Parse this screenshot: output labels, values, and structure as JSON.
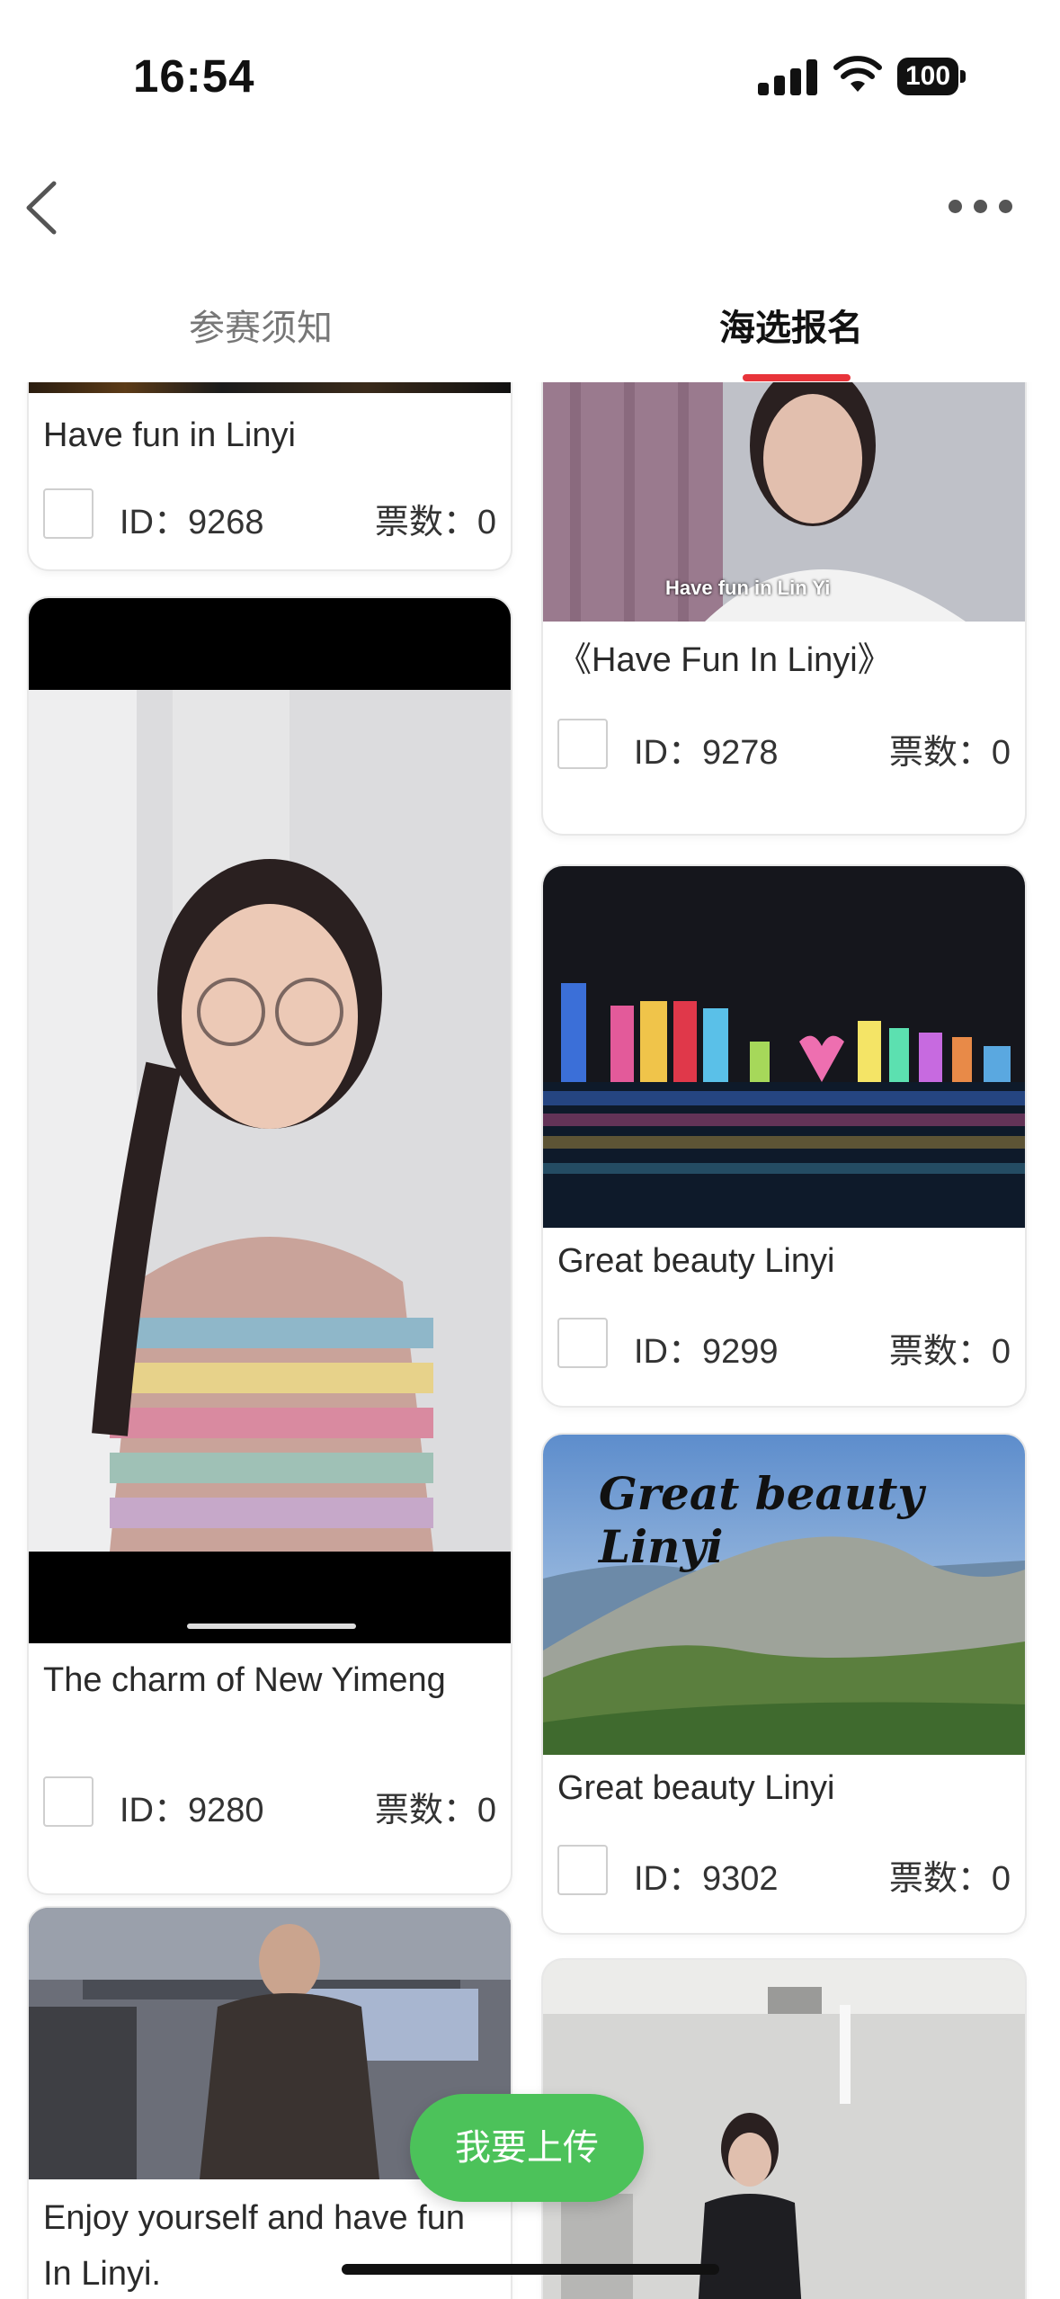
{
  "status_bar": {
    "time": "16:54",
    "battery": "100"
  },
  "nav": {
    "back_icon": "chevron-left-icon",
    "more_icon": "more-dots-icon"
  },
  "tabs": [
    {
      "label": "参赛须知",
      "active": false
    },
    {
      "label": "海选报名",
      "active": true
    }
  ],
  "accent_color": "#e8343a",
  "cards": [
    {
      "title": "Have fun in Linyi",
      "id_label": "ID：9268",
      "votes_label": "票数：0",
      "image": "video-thumbnail"
    },
    {
      "title": "The charm of New Yimeng",
      "id_label": "ID：9280",
      "votes_label": "票数：0",
      "image": "video-thumbnail-portrait-girl"
    },
    {
      "title": "Enjoy yourself and have fun In Linyi.",
      "image": "video-thumbnail-dorm"
    },
    {
      "title": "《Have Fun In Linyi》",
      "id_label": "ID：9278",
      "votes_label": "票数：0",
      "image": "video-thumbnail-girl-curtain",
      "caption": "Have fun in Lin Yi"
    },
    {
      "title": "Great beauty Linyi",
      "id_label": "ID：9299",
      "votes_label": "票数：0",
      "image": "night-city-skyline"
    },
    {
      "title": "Great beauty Linyi",
      "id_label": "ID：9302",
      "votes_label": "票数：0",
      "image": "mountain-landscape",
      "overlay_text": "Great beauty Linyi"
    },
    {
      "image": "classroom-girl"
    }
  ],
  "upload_button": {
    "label": "我要上传",
    "color": "#4cc25a"
  }
}
